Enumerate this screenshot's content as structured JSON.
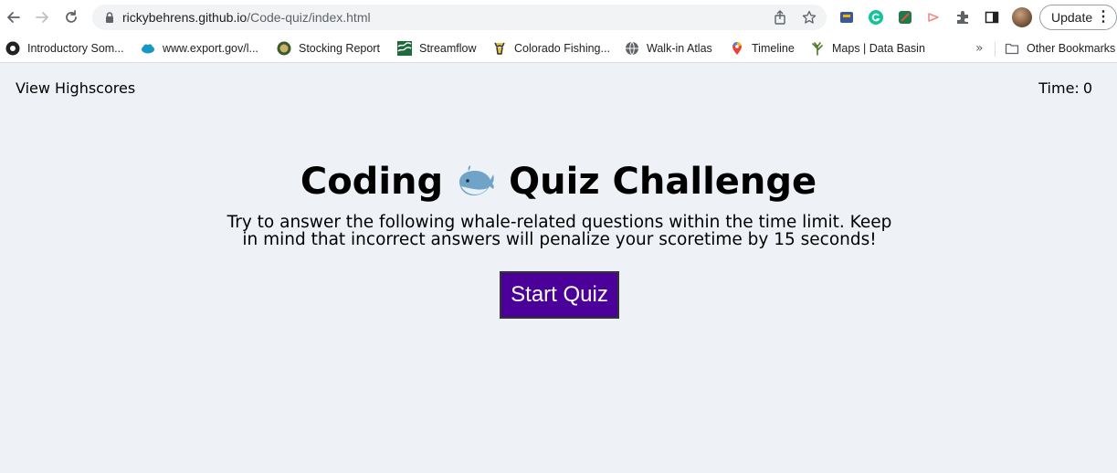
{
  "browser": {
    "url_host": "rickybehrens.github.io",
    "url_path": "/Code-quiz/index.html",
    "update_label": "Update",
    "bookmarks": [
      {
        "label": "Introductory Som..."
      },
      {
        "label": "www.export.gov/l..."
      },
      {
        "label": "Stocking Report"
      },
      {
        "label": "Streamflow"
      },
      {
        "label": "Colorado Fishing..."
      },
      {
        "label": "Walk-in Atlas"
      },
      {
        "label": "Timeline"
      },
      {
        "label": "Maps | Data Basin"
      }
    ],
    "other_bookmarks": "Other Bookmarks",
    "overflow": "»"
  },
  "header": {
    "highscores_label": "View Highscores",
    "timer_label": "Time:",
    "timer_value": "0"
  },
  "main": {
    "title_before": "Coding",
    "title_after": "Quiz Challenge",
    "intro_line1": "Try to answer the following whale-related questions within the time limit. Keep",
    "intro_line2": "in mind that incorrect answers will penalize your scoretime by 15 seconds!",
    "start_label": "Start Quiz"
  },
  "colors": {
    "page_background": "#eef2f6",
    "start_button": "#4b0099"
  }
}
